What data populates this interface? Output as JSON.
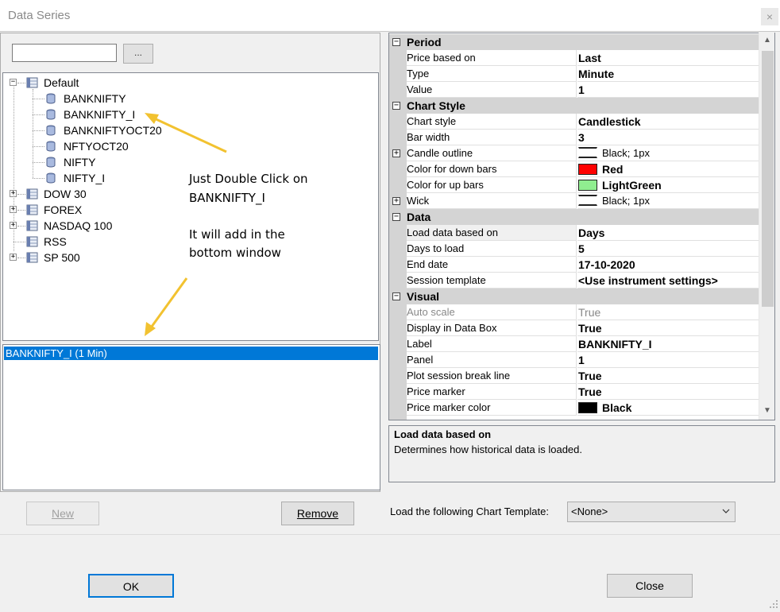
{
  "window": {
    "title": "Data Series",
    "close_glyph": "×"
  },
  "left": {
    "search": {
      "value": "",
      "browse_label": "..."
    },
    "tree": [
      {
        "label": "Default",
        "expanded": true,
        "kind": "folder"
      },
      {
        "label": "BANKNIFTY",
        "kind": "leaf"
      },
      {
        "label": "BANKNIFTY_I",
        "kind": "leaf"
      },
      {
        "label": "BANKNIFTYOCT20",
        "kind": "leaf"
      },
      {
        "label": "NFTYOCT20",
        "kind": "leaf"
      },
      {
        "label": "NIFTY",
        "kind": "leaf"
      },
      {
        "label": "NIFTY_I",
        "kind": "leaf"
      },
      {
        "label": "DOW 30",
        "expanded": false,
        "kind": "folder"
      },
      {
        "label": "FOREX",
        "expanded": false,
        "kind": "folder"
      },
      {
        "label": "NASDAQ 100",
        "expanded": false,
        "kind": "folder"
      },
      {
        "label": "RSS",
        "kind": "folder-noexp"
      },
      {
        "label": "SP 500",
        "expanded": false,
        "kind": "folder"
      }
    ],
    "annotation": {
      "line1": "Just Double Click on",
      "line2": "BANKNIFTY_I",
      "line3": "It will add in the",
      "line4": "bottom window"
    },
    "selected_series": "BANKNIFTY_I (1 Min)",
    "new_label": "New",
    "remove_label": "Remove"
  },
  "properties": {
    "categories": [
      {
        "name": "Period",
        "rows": [
          {
            "name": "Price based on",
            "value": "Last"
          },
          {
            "name": "Type",
            "value": "Minute"
          },
          {
            "name": "Value",
            "value": "1"
          }
        ]
      },
      {
        "name": "Chart Style",
        "rows": [
          {
            "name": "Chart style",
            "value": "Candlestick"
          },
          {
            "name": "Bar width",
            "value": "3"
          },
          {
            "name": "Candle outline",
            "value": "Black; 1px",
            "expandable": true,
            "swatch": "line"
          },
          {
            "name": "Color for down bars",
            "value": "Red",
            "swatch": "#ff0000"
          },
          {
            "name": "Color for up bars",
            "value": "LightGreen",
            "swatch": "#90ee90"
          },
          {
            "name": "Wick",
            "value": "Black; 1px",
            "expandable": true,
            "swatch": "line"
          }
        ]
      },
      {
        "name": "Data",
        "rows": [
          {
            "name": "Load data based on",
            "value": "Days",
            "highlight": true
          },
          {
            "name": "Days to load",
            "value": "5"
          },
          {
            "name": "End date",
            "value": "17-10-2020"
          },
          {
            "name": "Session template",
            "value": "<Use instrument settings>"
          }
        ]
      },
      {
        "name": "Visual",
        "rows": [
          {
            "name": "Auto scale",
            "value": "True",
            "disabled": true
          },
          {
            "name": "Display in Data Box",
            "value": "True"
          },
          {
            "name": "Label",
            "value": "BANKNIFTY_I"
          },
          {
            "name": "Panel",
            "value": "1"
          },
          {
            "name": "Plot session break line",
            "value": "True"
          },
          {
            "name": "Price marker",
            "value": "True"
          },
          {
            "name": "Price marker color",
            "value": "Black",
            "swatch": "#000000"
          }
        ]
      }
    ],
    "description": {
      "title": "Load data based on",
      "text": "Determines how historical data is loaded."
    }
  },
  "template": {
    "label": "Load the following Chart Template:",
    "selected": "<None>"
  },
  "footer": {
    "ok_label": "OK",
    "close_label": "Close"
  }
}
